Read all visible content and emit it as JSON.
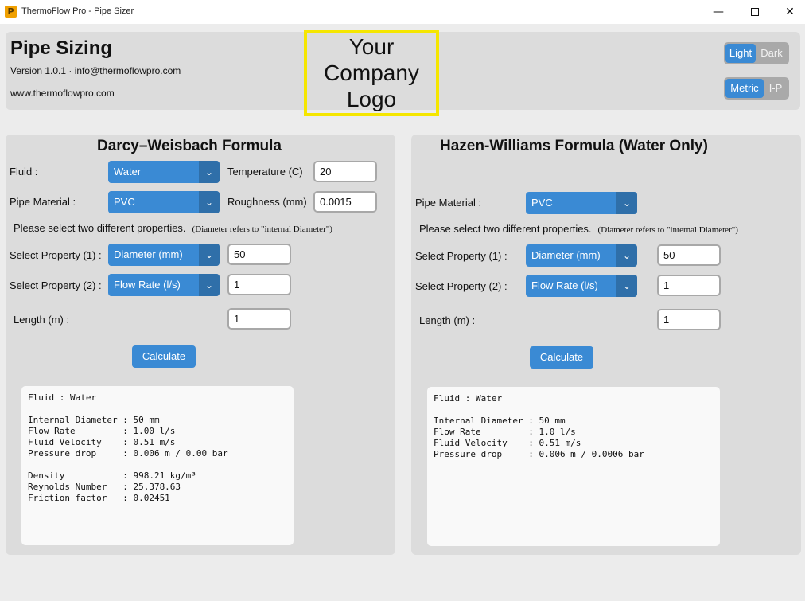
{
  "window": {
    "title": "ThermoFlow Pro - Pipe Sizer",
    "icon_letter": "P",
    "minimize": "—",
    "close": "✕"
  },
  "header": {
    "app_title": "Pipe Sizing",
    "version_line": "Version 1.0.1  ·  info@thermoflowpro.com",
    "website": "www.thermoflowpro.com",
    "logo_lines": [
      "Your",
      "Company",
      "Logo"
    ],
    "theme_toggle": {
      "selected": "Light",
      "other": "Dark"
    },
    "unit_toggle": {
      "selected": "Metric",
      "other": "I-P"
    }
  },
  "darcy": {
    "title": "Darcy–Weisbach Formula",
    "fluid_label": "Fluid :",
    "fluid_value": "Water",
    "temperature_label": "Temperature (C)",
    "temperature_value": "20",
    "material_label": "Pipe Material :",
    "material_value": "PVC",
    "roughness_label": "Roughness (mm)",
    "roughness_value": "0.0015",
    "instruction": "Please select two different properties.",
    "instruction_note": "(Diameter refers to \"internal Diameter\")",
    "prop1_label": "Select Property (1) :",
    "prop1_value": "Diameter (mm)",
    "prop1_input": "50",
    "prop2_label": "Select Property (2) :",
    "prop2_value": "Flow Rate (l/s)",
    "prop2_input": "1",
    "length_label": "Length (m) :",
    "length_value": "1",
    "calculate": "Calculate",
    "results": {
      "fluid": "Fluid : Water",
      "block1": [
        "Internal Diameter : 50 mm",
        "Flow Rate         : 1.00 l/s",
        "Fluid Velocity    : 0.51 m/s",
        "Pressure drop     : 0.006 m / 0.00 bar"
      ],
      "block2": [
        "Density           : 998.21 kg/m³",
        "Reynolds Number   : 25,378.63",
        "Friction factor   : 0.02451"
      ]
    }
  },
  "hazen": {
    "title": "Hazen-Williams Formula (Water Only)",
    "material_label": "Pipe Material :",
    "material_value": "PVC",
    "instruction": "Please select two different properties.",
    "instruction_note": "(Diameter refers to \"internal Diameter\")",
    "prop1_label": "Select Property (1) :",
    "prop1_value": "Diameter (mm)",
    "prop1_input": "50",
    "prop2_label": "Select Property (2) :",
    "prop2_value": "Flow Rate (l/s)",
    "prop2_input": "1",
    "length_label": "Length (m) :",
    "length_value": "1",
    "calculate": "Calculate",
    "results": {
      "fluid": "Fluid : Water",
      "block1": [
        "Internal Diameter : 50 mm",
        "Flow Rate         : 1.0 l/s",
        "Fluid Velocity    : 0.51 m/s",
        "Pressure drop     : 0.006 m / 0.0006 bar"
      ]
    }
  },
  "colors": {
    "accent": "#3a8ad4",
    "accent_dark": "#2f6fa9",
    "panel": "#dcdcdc",
    "logo_border": "#f5e600"
  },
  "icons": {
    "dropdown": "chevron-down-icon",
    "maximize": "maximize-icon",
    "close": "close-icon",
    "minimize": "minimize-icon"
  }
}
